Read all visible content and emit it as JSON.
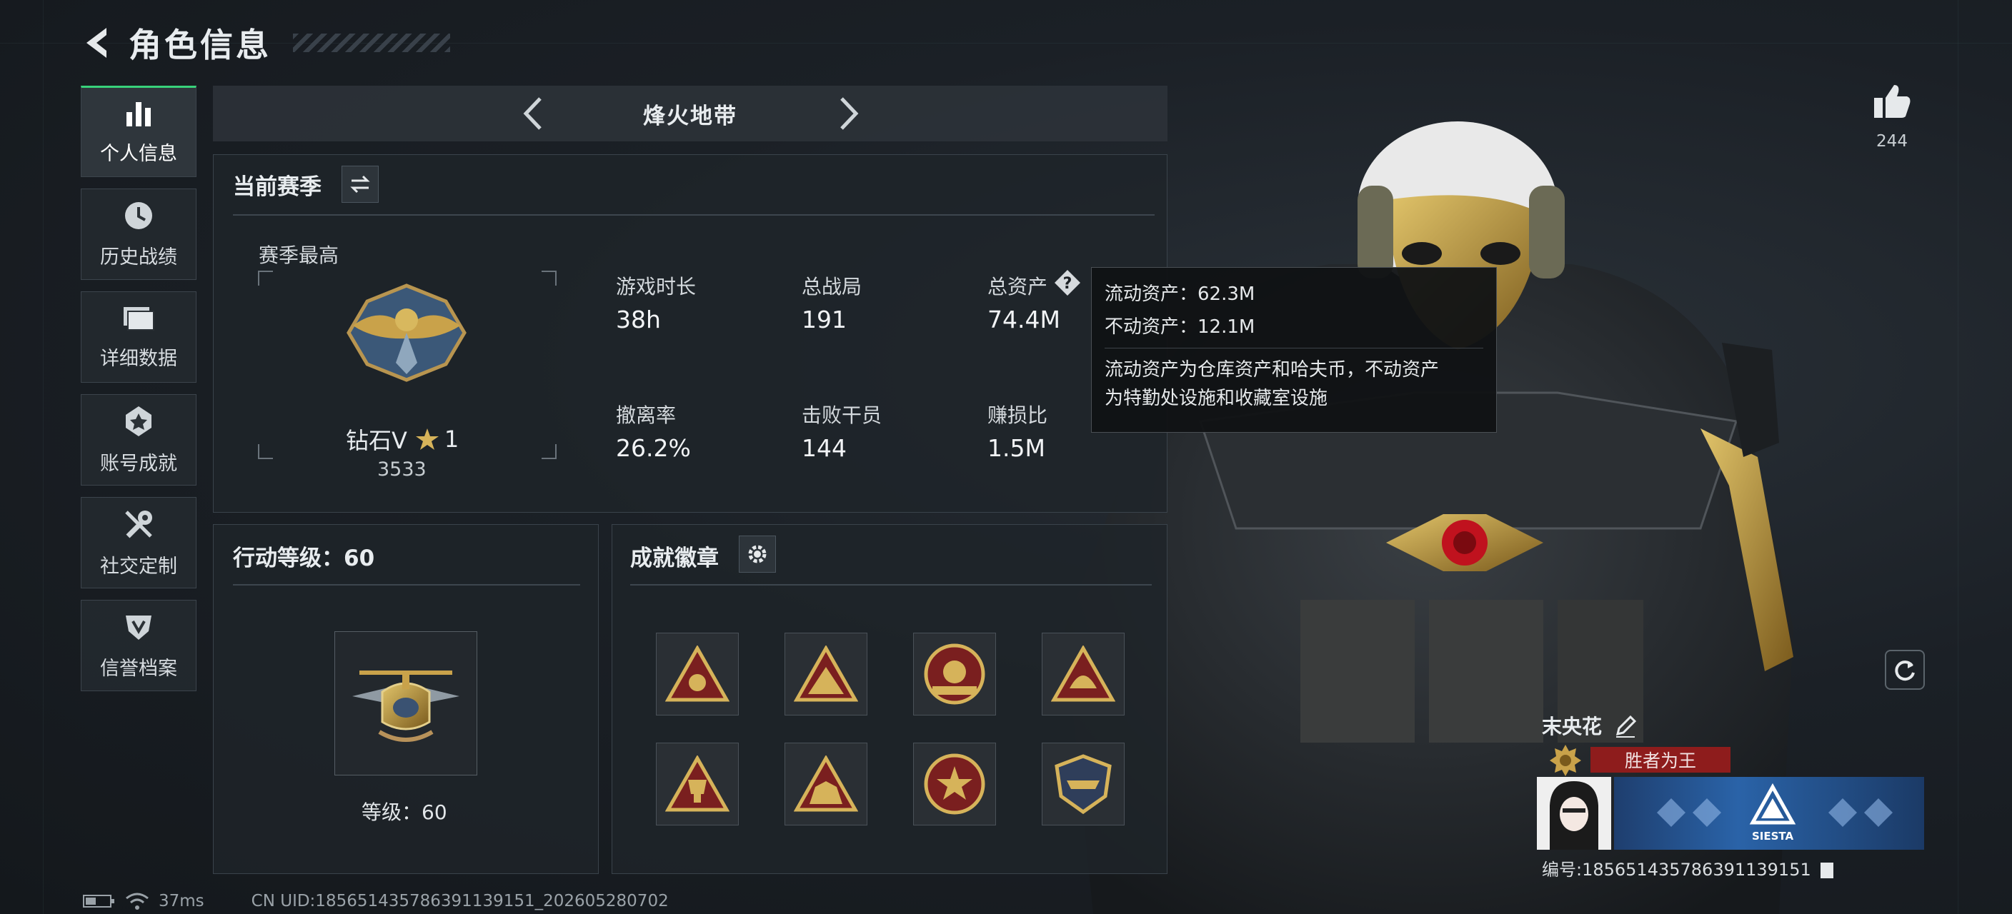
{
  "header": {
    "title": "角色信息"
  },
  "sidebar": {
    "items": [
      {
        "label": "个人信息",
        "icon": "bar-chart-icon",
        "active": true
      },
      {
        "label": "历史战绩",
        "icon": "clock-icon",
        "active": false
      },
      {
        "label": "详细数据",
        "icon": "folder-icon",
        "active": false
      },
      {
        "label": "账号成就",
        "icon": "medal-icon",
        "active": false
      },
      {
        "label": "社交定制",
        "icon": "wrench-icon",
        "active": false
      },
      {
        "label": "信誉档案",
        "icon": "shield-icon",
        "active": false
      }
    ]
  },
  "mode_selector": {
    "label": "烽火地带"
  },
  "season": {
    "title": "当前赛季",
    "best_label": "赛季最高",
    "rank": {
      "name": "钻石V",
      "stars": "1",
      "score": "3533"
    },
    "stats": [
      {
        "label": "游戏时长",
        "value": "38h"
      },
      {
        "label": "总战局",
        "value": "191"
      },
      {
        "label": "总资产",
        "value": "74.4M"
      },
      {
        "label": "撤离率",
        "value": "26.2%"
      },
      {
        "label": "击败干员",
        "value": "144"
      },
      {
        "label": "赚损比",
        "value": "1.5M"
      }
    ]
  },
  "tooltip": {
    "liquid": "流动资产：62.3M",
    "fixed": "不动资产：12.1M",
    "desc_line1": "流动资产为仓库资产和哈夫币，不动资产",
    "desc_line2": "为特勤处设施和收藏室设施"
  },
  "action_level": {
    "title": "行动等级：60",
    "level_text": "等级：60"
  },
  "badges": {
    "title": "成就徽章",
    "count": 8
  },
  "likes": {
    "count": "244"
  },
  "player": {
    "name": "末央花",
    "title": "胜者为王",
    "banner_text": "SIESTA",
    "uid": "编号:185651435786391139151"
  },
  "status_bar": {
    "ping": "37ms",
    "uid": "CN UID:185651435786391139151_202605280702"
  },
  "colors": {
    "accent": "#38d27a",
    "gold": "#c9a24a",
    "title_red": "#8e1c1c"
  }
}
